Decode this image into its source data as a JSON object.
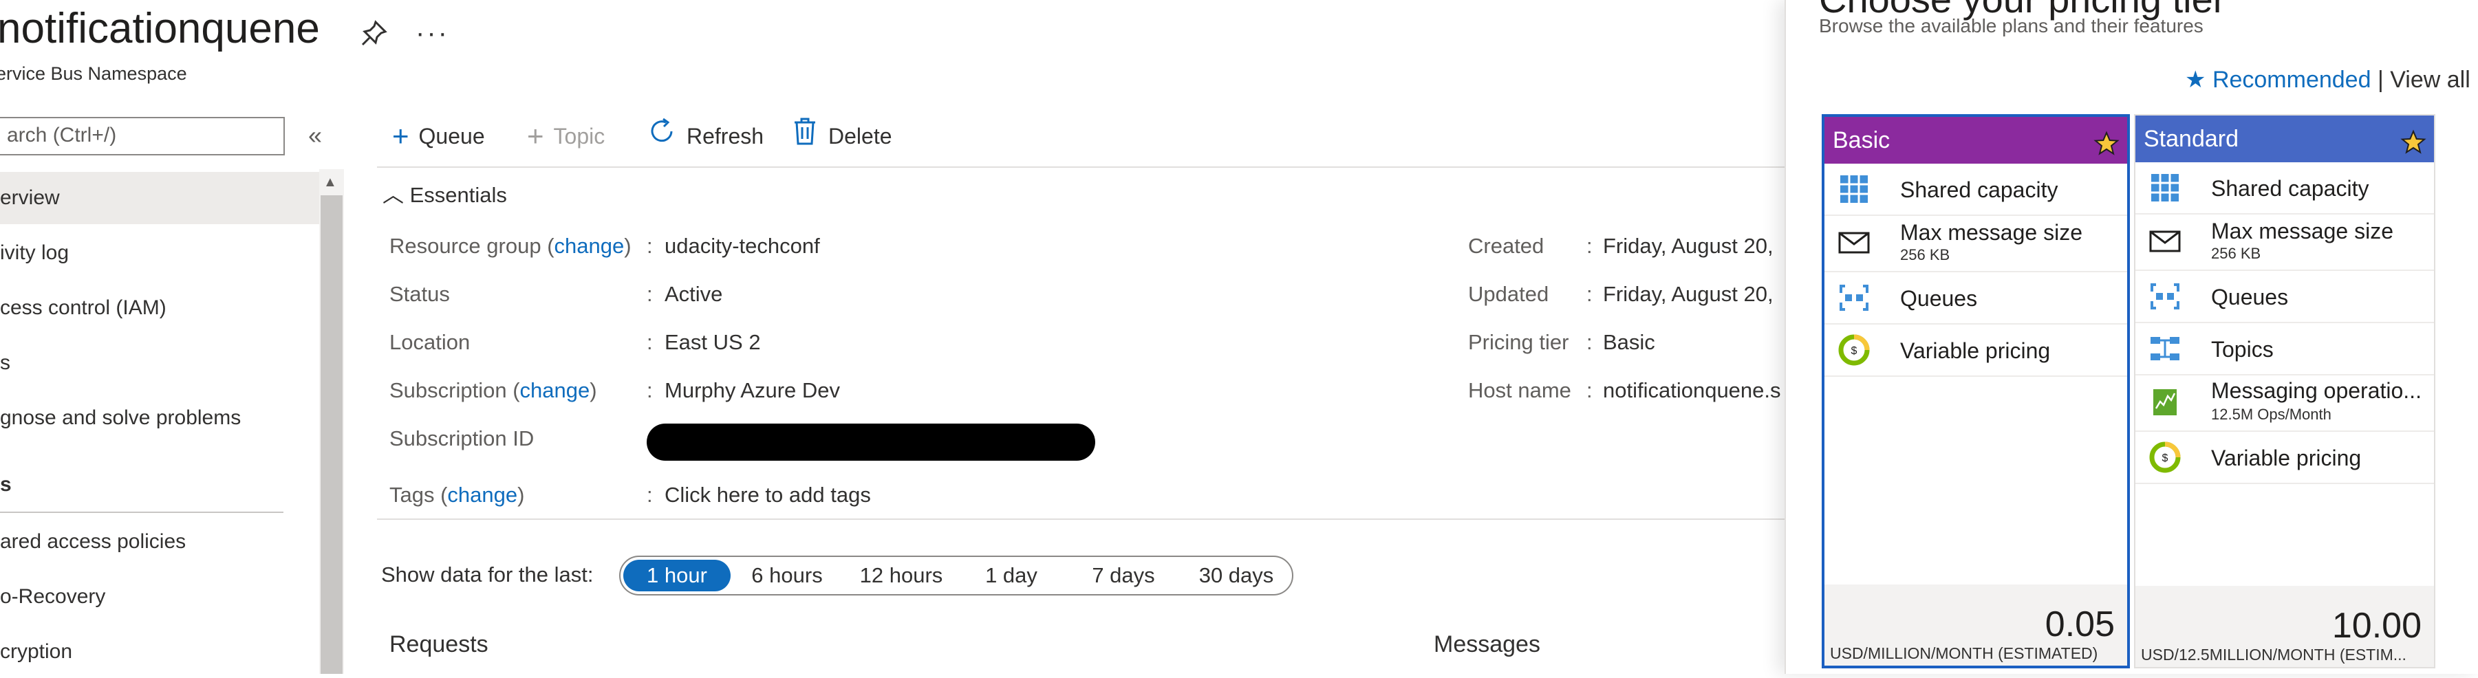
{
  "header": {
    "title": "notificationquene",
    "subtitle": "ervice Bus Namespace",
    "more": "···"
  },
  "sidebar": {
    "search_placeholder": "arch (Ctrl+/)",
    "collapse": "«",
    "items": [
      {
        "label": "erview",
        "selected": true
      },
      {
        "label": "ivity log"
      },
      {
        "label": "cess control (IAM)"
      },
      {
        "label": "s"
      },
      {
        "label": "gnose and solve problems"
      }
    ],
    "section_label": "s",
    "section_items": [
      {
        "label": "ared access policies"
      },
      {
        "label": "o-Recovery"
      },
      {
        "label": "cryption"
      }
    ]
  },
  "toolbar": {
    "queue": "Queue",
    "topic": "Topic",
    "refresh": "Refresh",
    "delete": "Delete"
  },
  "essentials": {
    "header": "Essentials",
    "rows_left": [
      {
        "label": "Resource group",
        "change": "change",
        "value": "udacity-techconf",
        "value_link": true
      },
      {
        "label": "Status",
        "value": "Active"
      },
      {
        "label": "Location",
        "value": "East US 2"
      },
      {
        "label": "Subscription",
        "change": "change",
        "value": "Murphy Azure Dev",
        "value_link": true
      },
      {
        "label": "Subscription ID",
        "value": ""
      },
      {
        "label": "Tags",
        "change": "change",
        "value": "Click here to add tags",
        "value_link": true
      }
    ],
    "rows_right": [
      {
        "label": "Created",
        "value": "Friday, August 20,"
      },
      {
        "label": "Updated",
        "value": "Friday, August 20,"
      },
      {
        "label": "Pricing tier",
        "value": "Basic",
        "value_link": true
      },
      {
        "label": "Host name",
        "value": "notificationquene.s"
      }
    ]
  },
  "time_range": {
    "label": "Show data for the last:",
    "options": [
      "1 hour",
      "6 hours",
      "12 hours",
      "1 day",
      "7 days",
      "30 days"
    ],
    "selected": "1 hour"
  },
  "metrics": {
    "requests_title": "Requests",
    "messages_title": "Messages"
  },
  "pricing": {
    "title": "Choose your pricing tier",
    "subtitle": "Browse the available plans and their features",
    "recommended": "Recommended",
    "view_all": "| View all",
    "tiers": [
      {
        "name": "Basic",
        "header_color": "#8b2a9e",
        "selected": true,
        "features": [
          {
            "label": "Shared capacity",
            "icon": "grid-icon"
          },
          {
            "label": "Max message size",
            "sub": "256 KB",
            "icon": "envelope-icon"
          },
          {
            "label": "Queues",
            "icon": "queue-icon"
          },
          {
            "label": "Variable pricing",
            "icon": "pricing-icon"
          }
        ],
        "price": "0.05",
        "unit": "USD/MILLION/MONTH (ESTIMATED)"
      },
      {
        "name": "Standard",
        "header_color": "#4668c5",
        "selected": false,
        "features": [
          {
            "label": "Shared capacity",
            "icon": "grid-icon"
          },
          {
            "label": "Max message size",
            "sub": "256 KB",
            "icon": "envelope-icon"
          },
          {
            "label": "Queues",
            "icon": "queue-icon"
          },
          {
            "label": "Topics",
            "icon": "topics-icon"
          },
          {
            "label": "Messaging operatio...",
            "sub": "12.5M Ops/Month",
            "icon": "chart-icon"
          },
          {
            "label": "Variable pricing",
            "icon": "pricing-icon"
          }
        ],
        "price": "10.00",
        "unit": "USD/12.5MILLION/MONTH (ESTIM..."
      }
    ]
  }
}
